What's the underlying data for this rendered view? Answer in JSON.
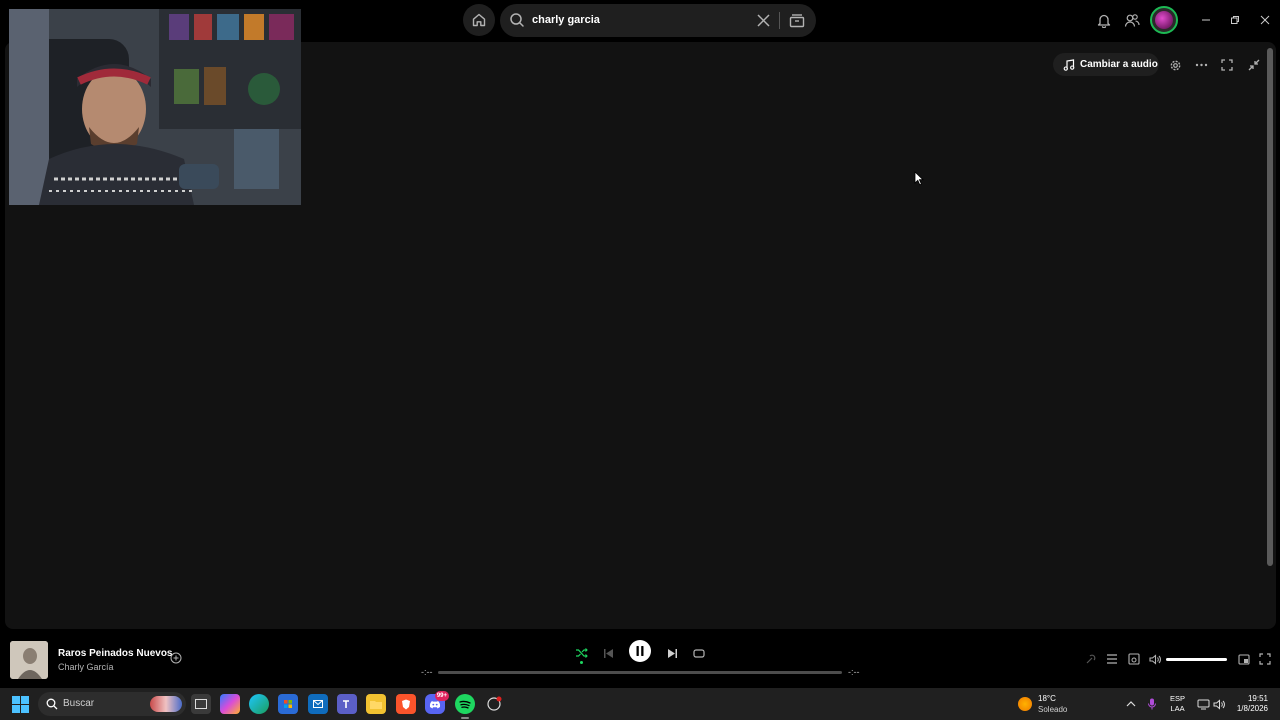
{
  "search": {
    "query": "charly garcia"
  },
  "toolbar": {
    "switch_audio_label": "Cambiar a audio"
  },
  "now_playing": {
    "title": "Raros Peinados Nuevos",
    "artist": "Charly García",
    "elapsed": "-:--",
    "duration": "-:--",
    "progress": 0,
    "volume": 1.0
  },
  "taskbar": {
    "search_label": "Buscar",
    "discord_badge": "99+",
    "weather": {
      "temp": "18°C",
      "condition": "Soleado"
    },
    "language": {
      "line1": "ESP",
      "line2": "LAA"
    },
    "clock": {
      "time": "19:51",
      "date": "1/8/2026"
    }
  },
  "colors": {
    "accent": "#1ed760",
    "panel": "#121212",
    "background": "#000000",
    "taskbar": "#202020"
  }
}
